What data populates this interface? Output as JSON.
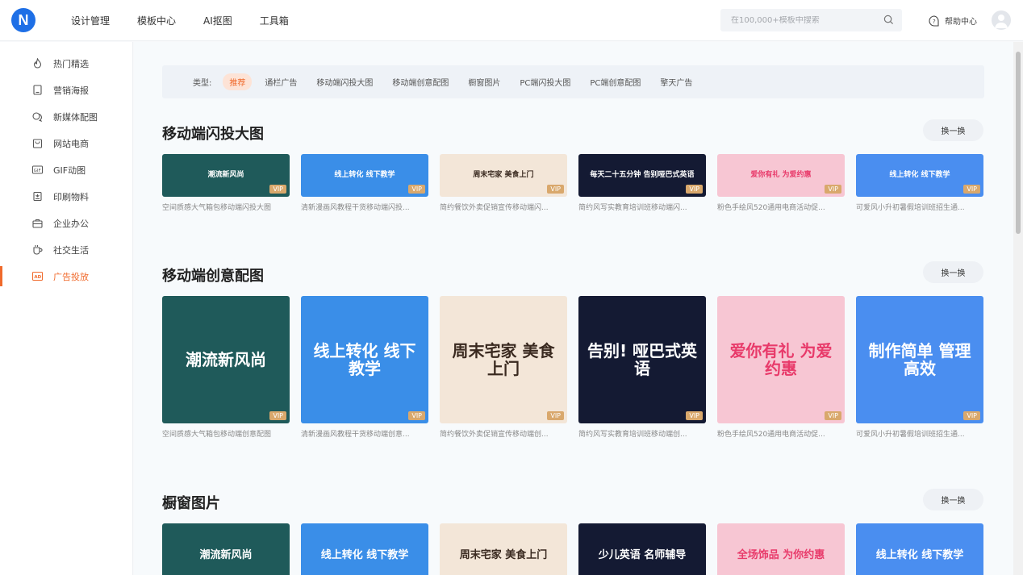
{
  "brand": {
    "letter": "N"
  },
  "nav": [
    {
      "label": "设计管理"
    },
    {
      "label": "模板中心"
    },
    {
      "label": "AI抠图"
    },
    {
      "label": "工具箱"
    }
  ],
  "search": {
    "placeholder": "在100,000+模板中搜索"
  },
  "help": {
    "label": "帮助中心"
  },
  "sidebar": {
    "items": [
      {
        "label": "热门精选",
        "icon": "fire-icon"
      },
      {
        "label": "营销海报",
        "icon": "poster-icon"
      },
      {
        "label": "新媒体配图",
        "icon": "chat-icon"
      },
      {
        "label": "网站电商",
        "icon": "shop-icon"
      },
      {
        "label": "GIF动图",
        "icon": "gif-icon"
      },
      {
        "label": "印刷物料",
        "icon": "print-icon"
      },
      {
        "label": "企业办公",
        "icon": "briefcase-icon"
      },
      {
        "label": "社交生活",
        "icon": "cup-icon"
      },
      {
        "label": "广告投放",
        "icon": "ad-icon",
        "active": true
      }
    ]
  },
  "filter": {
    "label": "类型:",
    "chips": [
      "推荐",
      "通栏广告",
      "移动端闪投大图",
      "移动端创意配图",
      "橱窗图片",
      "PC端闪投大图",
      "PC端创意配图",
      "擎天广告"
    ]
  },
  "swap_label": "换一换",
  "vip_label": "VIP",
  "sections": [
    {
      "title": "移动端闪投大图",
      "cards": [
        {
          "thumb_text": "潮流新风尚",
          "caption": "空间质感大气箱包移动端闪投大图",
          "bg": "#1f5a5a"
        },
        {
          "thumb_text": "线上转化 线下教学",
          "caption": "清新漫画风教程干货移动端闪投...",
          "bg": "#3a8ee8"
        },
        {
          "thumb_text": "周末宅家 美食上门",
          "caption": "简约餐饮外卖促销宣传移动端闪...",
          "bg": "#f3e6d8"
        },
        {
          "thumb_text": "每天二十五分钟 告别哑巴式英语",
          "caption": "简约风写实教育培训班移动端闪...",
          "bg": "#141a33"
        },
        {
          "thumb_text": "爱你有礼 为爱约惠",
          "caption": "粉色手绘风520通用电商活动促...",
          "bg": "#f7c6d3"
        },
        {
          "thumb_text": "线上转化 线下教学",
          "caption": "可爱风小升初暑假培训班招生通...",
          "bg": "#4a8ef0"
        }
      ]
    },
    {
      "title": "移动端创意配图",
      "cards": [
        {
          "thumb_text": "潮流新风尚",
          "caption": "空间质感大气箱包移动端创意配图",
          "bg": "#1f5a5a"
        },
        {
          "thumb_text": "线上转化 线下教学",
          "caption": "清新漫画风教程干货移动端创意...",
          "bg": "#3a8ee8"
        },
        {
          "thumb_text": "周末宅家 美食上门",
          "caption": "简约餐饮外卖促销宣传移动端创...",
          "bg": "#f3e6d8"
        },
        {
          "thumb_text": "告别! 哑巴式英语",
          "caption": "简约风写实教育培训班移动端创...",
          "bg": "#141a33"
        },
        {
          "thumb_text": "爱你有礼 为爱约惠",
          "caption": "粉色手绘风520通用电商活动促...",
          "bg": "#f7c6d3"
        },
        {
          "thumb_text": "制作简单 管理高效",
          "caption": "可爱风小升初暑假培训班招生通...",
          "bg": "#4a8ef0"
        }
      ]
    },
    {
      "title": "橱窗图片",
      "cards": [
        {
          "thumb_text": "潮流新风尚",
          "bg": "#1f5a5a"
        },
        {
          "thumb_text": "线上转化 线下教学",
          "bg": "#3a8ee8"
        },
        {
          "thumb_text": "周末宅家 美食上门",
          "bg": "#f3e6d8"
        },
        {
          "thumb_text": "少儿英语 名师辅导",
          "bg": "#141a33"
        },
        {
          "thumb_text": "全场饰品 为你约惠",
          "bg": "#f7c6d3"
        },
        {
          "thumb_text": "线上转化 线下教学",
          "bg": "#4a8ef0"
        }
      ]
    }
  ]
}
